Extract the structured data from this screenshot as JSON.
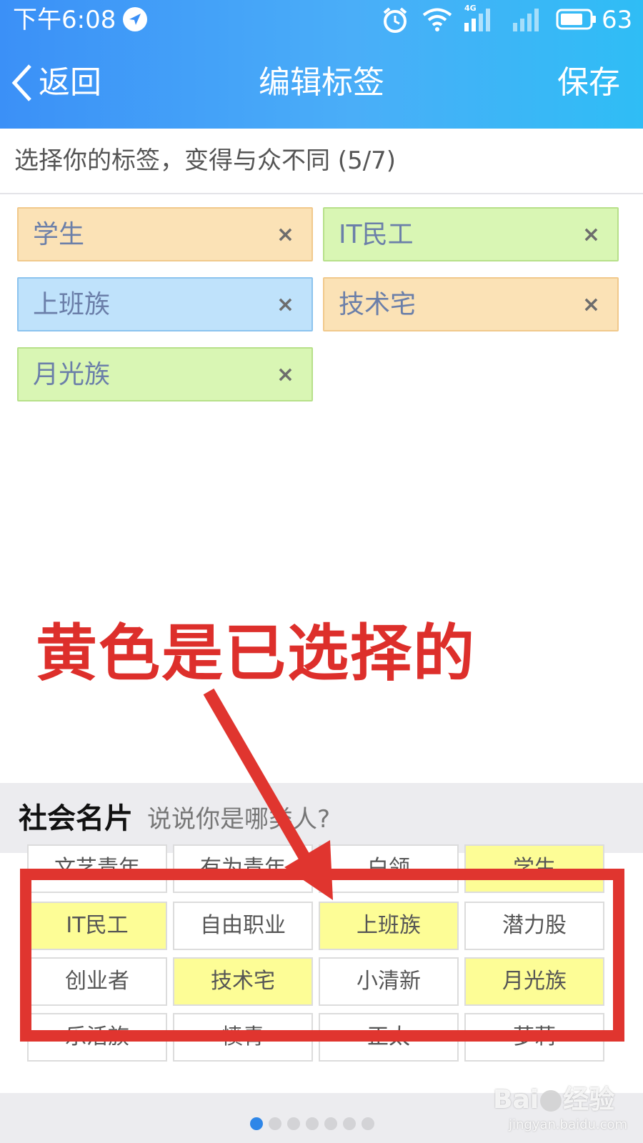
{
  "status_bar": {
    "time": "下午6:08",
    "network_type": "4G",
    "battery": "63",
    "icons": [
      "message-icon",
      "alarm-icon",
      "wifi-icon",
      "signal-icon",
      "signal-icon",
      "battery-icon"
    ]
  },
  "nav": {
    "back_label": "返回",
    "title": "编辑标签",
    "save_label": "保存"
  },
  "hint": "选择你的标签，变得与众不同 (5/7)",
  "selected_tags": [
    {
      "label": "学生",
      "color": "orange"
    },
    {
      "label": "IT民工",
      "color": "green"
    },
    {
      "label": "上班族",
      "color": "blue"
    },
    {
      "label": "技术宅",
      "color": "orange"
    },
    {
      "label": "月光族",
      "color": "green"
    }
  ],
  "remove_symbol": "×",
  "annotation": "黄色是已选择的",
  "social": {
    "title": "社会名片",
    "subtitle": "说说你是哪类人?",
    "cells": [
      {
        "label": "文艺青年",
        "selected": false
      },
      {
        "label": "有为青年",
        "selected": false
      },
      {
        "label": "白领",
        "selected": false
      },
      {
        "label": "学生",
        "selected": true
      },
      {
        "label": "IT民工",
        "selected": true
      },
      {
        "label": "自由职业",
        "selected": false
      },
      {
        "label": "上班族",
        "selected": true
      },
      {
        "label": "潜力股",
        "selected": false
      },
      {
        "label": "创业者",
        "selected": false
      },
      {
        "label": "技术宅",
        "selected": true
      },
      {
        "label": "小清新",
        "selected": false
      },
      {
        "label": "月光族",
        "selected": true
      },
      {
        "label": "乐活族",
        "selected": false
      },
      {
        "label": "愤青",
        "selected": false
      },
      {
        "label": "正太",
        "selected": false
      },
      {
        "label": "萝莉",
        "selected": false
      }
    ]
  },
  "pager": {
    "count": 7,
    "active": 0
  },
  "watermark": {
    "brand_left": "Bai",
    "brand_right": "经验",
    "url": "jingyan.baidu.com"
  },
  "colors": {
    "header_start": "#3b90f7",
    "header_end": "#2fbdf5",
    "chip_orange": "#fbe2b6",
    "chip_green": "#d9f6b4",
    "chip_blue": "#bfe2fb",
    "selected_cell": "#fdfd96",
    "annotation_red": "#dd2f2b",
    "pager_active": "#2e86e8"
  }
}
